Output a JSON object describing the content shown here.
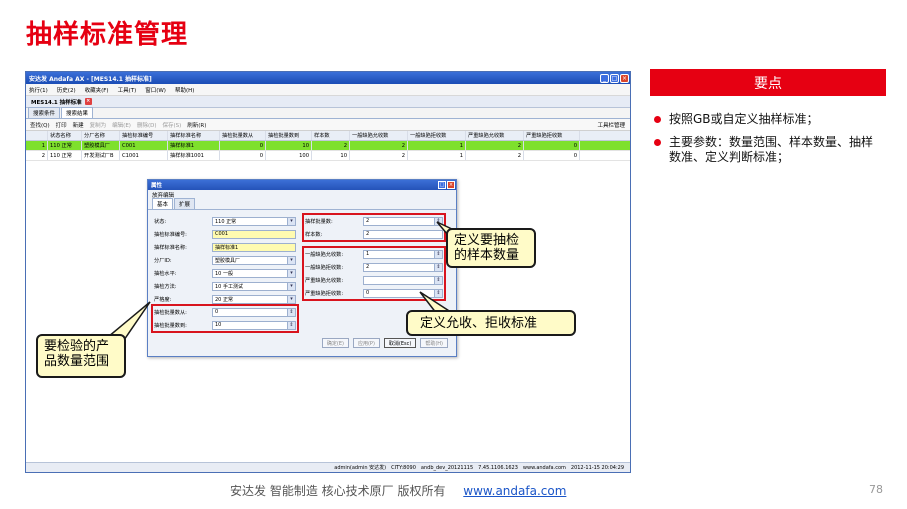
{
  "slide_title": "抽样标准管理",
  "app": {
    "window_title": "安达发 Andafa AX - [MES14.1 抽样标准]",
    "menu": [
      "执行(1)",
      "历史(2)",
      "收藏夹(F)",
      "工具(T)",
      "窗口(W)",
      "帮助(H)"
    ],
    "doc_tab": "MES14.1 抽样标准",
    "sub_tabs": [
      "搜索条件",
      "搜索结果"
    ],
    "toolbar": {
      "search": "查找(Q)",
      "print": "打印",
      "new": "新建",
      "copy": "复制为",
      "edit": "编辑(E)",
      "delete": "删除(D)",
      "save": "保存(S)",
      "refresh": "刷新(R)",
      "tools": "工具栏管理"
    },
    "grid": {
      "columns": [
        "状态名称",
        "分厂名称",
        "抽检标准编号",
        "抽样标准名称",
        "抽检批量数从",
        "抽检批量数到",
        "样本数",
        "一般缺陷允收数",
        "一般缺陷拒收数",
        "严重缺陷允收数",
        "严重缺陷拒收数"
      ],
      "rows": [
        {
          "no": "1",
          "cells": [
            "110 正常",
            "塑胶模具厂",
            "C001",
            "抽样标准1",
            "0",
            "10",
            "2",
            "2",
            "1",
            "2",
            "0",
            "1"
          ]
        },
        {
          "no": "2",
          "cells": [
            "110 正常",
            "开发测试厂B",
            "C1001",
            "抽样标准1001",
            "0",
            "100",
            "10",
            "2",
            "1",
            "2",
            "0",
            "1"
          ]
        }
      ]
    },
    "dialog": {
      "title": "属性",
      "tool": "放弃编辑",
      "tabs": [
        "基本",
        "扩展"
      ],
      "left_fields": [
        {
          "label": "状态:",
          "value": "110 正常",
          "dropdown": true
        },
        {
          "label": "抽检标准编号:",
          "value": "C001",
          "dropdown": false,
          "yellow": true
        },
        {
          "label": "抽样标准名称:",
          "value": "抽样标准1",
          "dropdown": false,
          "yellow": true
        },
        {
          "label": "分厂ID:",
          "value": "塑胶模具厂",
          "dropdown": true
        },
        {
          "label": "抽检水平:",
          "value": "10 一般",
          "dropdown": true
        },
        {
          "label": "抽检方法:",
          "value": "10 手工测试",
          "dropdown": true
        },
        {
          "label": "严格度:",
          "value": "20 正常",
          "dropdown": true
        },
        {
          "label": "抽检批量数从:",
          "value": "0",
          "dropdown": true
        },
        {
          "label": "抽检批量数到:",
          "value": "10",
          "dropdown": true
        }
      ],
      "right_fields": [
        {
          "label": "抽样批量数:",
          "value": "2"
        },
        {
          "label": "样本数:",
          "value": "2"
        },
        {
          "label": "一般缺陷允收数:",
          "value": "1"
        },
        {
          "label": "一般缺陷拒收数:",
          "value": "2"
        },
        {
          "label": "严重缺陷允收数:",
          "value": ""
        },
        {
          "label": "严重缺陷拒收数:",
          "value": "0"
        }
      ],
      "buttons": [
        "确定(E)",
        "应用(P)",
        "取消(Esc)",
        "帮助(H)"
      ]
    },
    "status": [
      "admin(admin 安达发)",
      "CITY:8090",
      "andb_dev_20121115",
      "7.45.1106.1623",
      "www.andafa.com",
      "2012-11-15 20:04:29"
    ]
  },
  "callouts": {
    "sample": "定义要抽检\n的样本数量",
    "accept": "定义允收、拒收标准",
    "range": "要检验的产\n品数量范围"
  },
  "key_points": {
    "header": "要点",
    "items": [
      "按照GB或自定义抽样标准；",
      "主要参数：数量范围、样本数量、抽样数准、定义判断标准；"
    ]
  },
  "footer": {
    "text": "安达发   智能制造 核心技术原厂   版权所有",
    "url": "www.andafa.com",
    "page": "78"
  }
}
